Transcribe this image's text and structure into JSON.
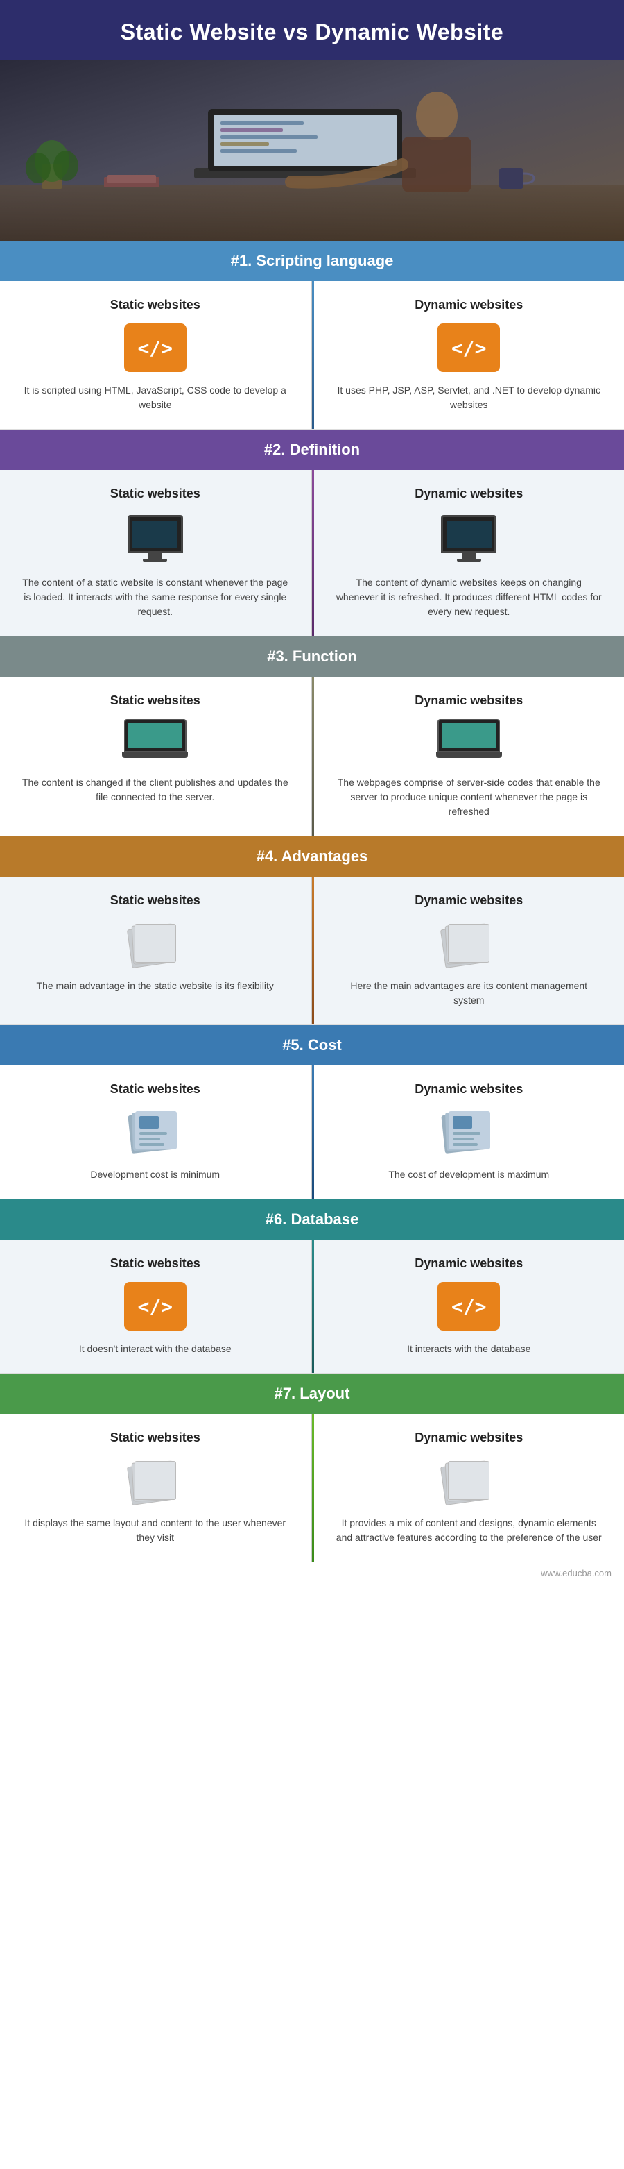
{
  "title": "Static Website vs Dynamic Website",
  "hero": {
    "alt": "Person working on laptop at desk"
  },
  "sections": [
    {
      "id": "scripting",
      "number": "#1.",
      "label": "Scripting language",
      "header_class": "blue",
      "divider_class": "",
      "static_title": "Static websites",
      "static_text": "It is scripted using HTML, JavaScript, CSS code to develop a website",
      "static_icon": "code",
      "dynamic_title": "Dynamic websites",
      "dynamic_text": "It uses PHP, JSP, ASP, Servlet, and .NET to develop dynamic websites",
      "dynamic_icon": "code"
    },
    {
      "id": "definition",
      "number": "#2.",
      "label": "Definition",
      "header_class": "purple",
      "divider_class": "purple",
      "static_title": "Static websites",
      "static_text": "The content of a static website is constant whenever the page is loaded. It interacts with the same response for every single request.",
      "static_icon": "monitor",
      "dynamic_title": "Dynamic websites",
      "dynamic_text": "The content of dynamic websites keeps on changing whenever it is refreshed. It produces different HTML codes for every new request.",
      "dynamic_icon": "monitor"
    },
    {
      "id": "function",
      "number": "#3.",
      "label": "Function",
      "header_class": "gray",
      "divider_class": "gray",
      "static_title": "Static websites",
      "static_text": "The content is changed if the client publishes and updates the file connected to the server.",
      "static_icon": "laptop",
      "dynamic_title": "Dynamic websites",
      "dynamic_text": "The webpages comprise of server-side codes that enable the server to produce unique content whenever the page is refreshed",
      "dynamic_icon": "laptop"
    },
    {
      "id": "advantages",
      "number": "#4.",
      "label": "Advantages",
      "header_class": "brown",
      "divider_class": "brown",
      "static_title": "Static websites",
      "static_text": "The main advantage in the static website is its flexibility",
      "static_icon": "files",
      "dynamic_title": "Dynamic websites",
      "dynamic_text": "Here the main advantages are its content management system",
      "dynamic_icon": "files"
    },
    {
      "id": "cost",
      "number": "#5.",
      "label": "Cost",
      "header_class": "blue2",
      "divider_class": "blue2",
      "static_title": "Static websites",
      "static_text": "Development cost is minimum",
      "static_icon": "cost",
      "dynamic_title": "Dynamic websites",
      "dynamic_text": "The cost of development is maximum",
      "dynamic_icon": "cost"
    },
    {
      "id": "database",
      "number": "#6.",
      "label": "Database",
      "header_class": "teal",
      "divider_class": "teal",
      "static_title": "Static websites",
      "static_text": "It doesn't interact with the database",
      "static_icon": "code-orange",
      "dynamic_title": "Dynamic websites",
      "dynamic_text": "It interacts with the database",
      "dynamic_icon": "code-orange"
    },
    {
      "id": "layout",
      "number": "#7.",
      "label": "Layout",
      "header_class": "green",
      "divider_class": "green",
      "static_title": "Static websites",
      "static_text": "It displays the same layout and content to the user whenever they visit",
      "static_icon": "files",
      "dynamic_title": "Dynamic websites",
      "dynamic_text": "It provides a mix of content and designs, dynamic elements and attractive features according to the preference of the user",
      "dynamic_icon": "files"
    }
  ],
  "watermark": "www.educba.com"
}
